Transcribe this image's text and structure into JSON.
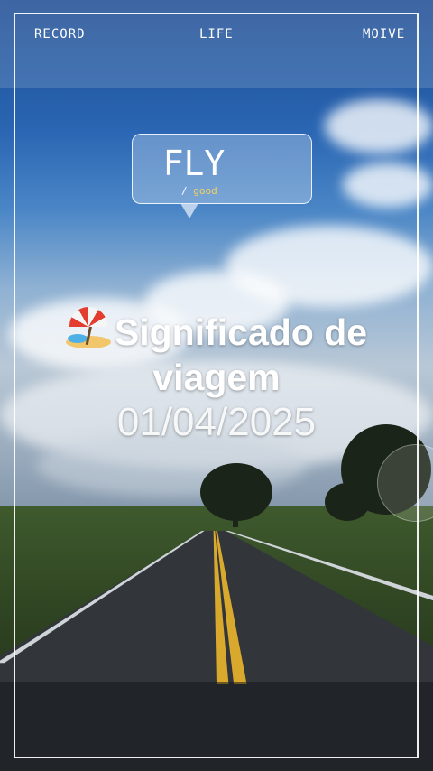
{
  "nav": {
    "left": "RECORD",
    "center": "LIFE",
    "right": "MOIVE"
  },
  "bubble": {
    "title": "FLY",
    "sub_prefix": "/",
    "sub_word": "good"
  },
  "caption": {
    "emoji": "beach-umbrella",
    "title_line1": "Significado de",
    "title_line2": "viagem",
    "date": "01/04/2025"
  },
  "colors": {
    "frame": "#ffffff",
    "accent_word": "#f3d35a",
    "sky": "#2a66b3",
    "road_line": "#d9a92e"
  }
}
